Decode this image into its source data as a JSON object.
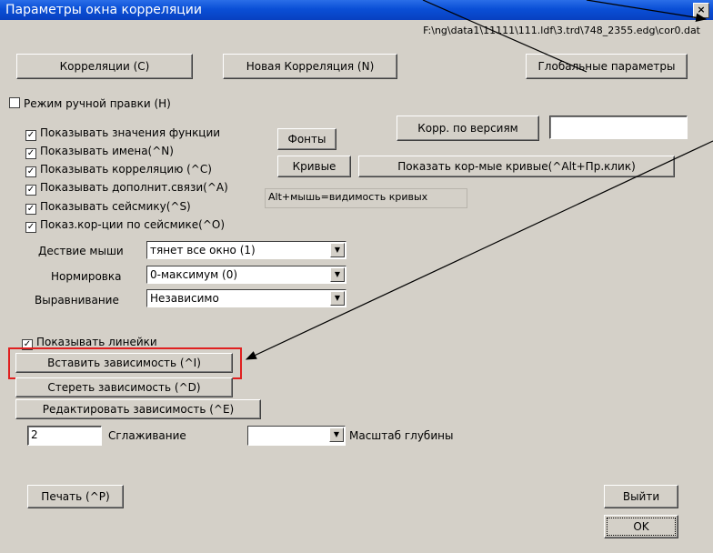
{
  "window": {
    "title": "Параметры окна корреляции",
    "close_glyph": "×"
  },
  "path": "F:\\ng\\data1\\11111\\111.ldf\\3.trd\\748_2355.edg\\cor0.dat",
  "top_buttons": {
    "correlations": "Корреляции (C)",
    "new_correlation": "Новая Корреляция (N)",
    "global_params": "Глобальные параметры"
  },
  "manual_edit": {
    "label": "Режим ручной правки (H)",
    "checked": false
  },
  "show_options": [
    {
      "label": "Показывать значения функции",
      "checked": true
    },
    {
      "label": "Показывать имена(^N)",
      "checked": true
    },
    {
      "label": "Показывать корреляцию (^C)",
      "checked": true
    },
    {
      "label": "Показывать дополнит.связи(^A)",
      "checked": true
    },
    {
      "label": "Показывать сейсмику(^S)",
      "checked": true
    },
    {
      "label": "Показ.кор-ции по сейсмике(^O)",
      "checked": true
    }
  ],
  "fonts_button": "Фонты",
  "corr_by_version_button": "Корр. по версиям",
  "corr_by_version_value": "",
  "curves_button": "Кривые",
  "show_corr_curves_button": "Показать кор-мые кривые(^Alt+Пр.клик)",
  "hint_text": "Alt+мышь=видимость кривых",
  "mouse_action": {
    "label": "Дествие мыши",
    "value": "тянет все окно (1)"
  },
  "normalization": {
    "label": "Нормировка",
    "value": "0-максимум  (0)"
  },
  "alignment": {
    "label": "Выравнивание",
    "value": "Независимо"
  },
  "show_rulers": {
    "label": "Показывать линейки",
    "checked": true
  },
  "dependency_buttons": {
    "insert": "Вставить зависимость (^I)",
    "erase": "Стереть зависимость (^D)",
    "edit": "Редактировать зависимость (^E)"
  },
  "smoothing": {
    "value": "2",
    "label": "Сглаживание"
  },
  "depth_scale": {
    "value": "",
    "label": "Масштаб глубины"
  },
  "print_button": "Печать (^P)",
  "exit_button": "Выйти",
  "ok_button": "OK",
  "check_glyph": "✓",
  "colors": {
    "title_bar": "#0a4fd6",
    "highlight": "#e02020",
    "face": "#d4d0c8"
  }
}
